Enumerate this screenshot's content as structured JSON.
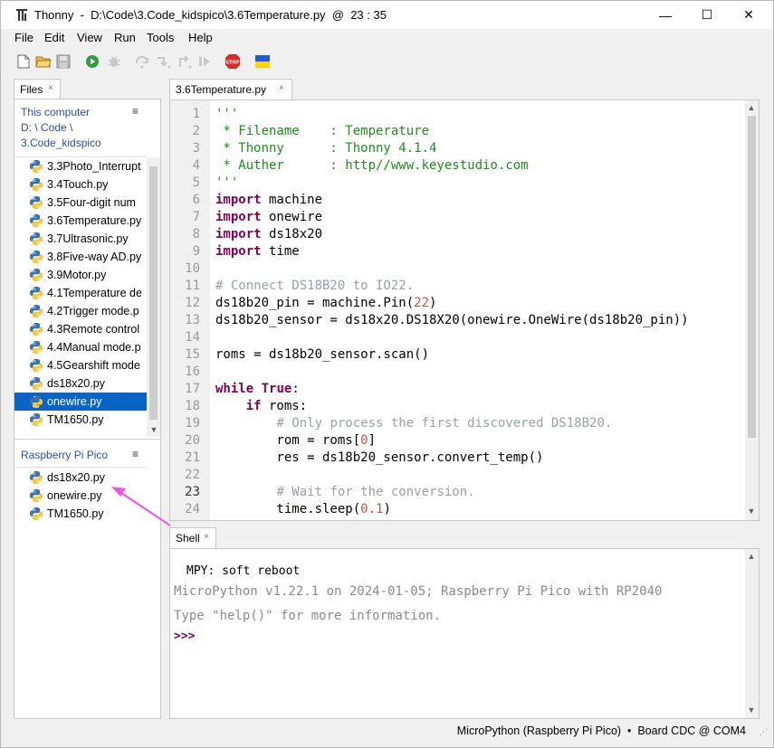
{
  "window": {
    "title": "Thonny  -  D:\\Code\\3.Code_kidspico\\3.6Temperature.py  @  23 : 35",
    "minimize": "—",
    "maximize": "☐",
    "close": "✕"
  },
  "menu": [
    "File",
    "Edit",
    "View",
    "Run",
    "Tools",
    "Help"
  ],
  "toolbar": {
    "icons": [
      "new-file-icon",
      "open-file-icon",
      "save-icon",
      "run-icon",
      "debug-icon",
      "step-over-icon",
      "step-into-icon",
      "step-out-icon",
      "resume-icon",
      "stop-icon",
      "ukraine-flag-icon"
    ],
    "stop_label": "STOP"
  },
  "files": {
    "tab_label": "Files",
    "close": "×",
    "computer": {
      "title_line1": "This computer",
      "title_line2": "D: \\ Code \\",
      "title_line3": "3.Code_kidspico",
      "items": [
        "3.3Photo_Interrupt",
        "3.4Touch.py",
        "3.5Four-digit  num",
        "3.6Temperature.py",
        "3.7Ultrasonic.py",
        "3.8Five-way AD.py",
        "3.9Motor.py",
        "4.1Temperature de",
        "4.2Trigger mode.p",
        "4.3Remote control",
        "4.4Manual mode.p",
        "4.5Gearshift mode",
        "ds18x20.py",
        "onewire.py",
        "TM1650.py"
      ],
      "selected_index": 13
    },
    "device": {
      "title": "Raspberry Pi Pico",
      "items": [
        "ds18x20.py",
        "onewire.py",
        "TM1650.py"
      ]
    },
    "menu_glyph": "≡"
  },
  "editor": {
    "tab_label": "3.6Temperature.py",
    "close": "×",
    "current_line": 23,
    "line_numbers": [
      "1",
      "2",
      "3",
      "4",
      "5",
      "6",
      "7",
      "8",
      "9",
      "10",
      "11",
      "12",
      "13",
      "14",
      "15",
      "16",
      "17",
      "18",
      "19",
      "20",
      "21",
      "22",
      "23",
      "24"
    ],
    "lines": [
      [
        [
          "str",
          "'''"
        ]
      ],
      [
        [
          "str",
          " * Filename    : Temperature"
        ]
      ],
      [
        [
          "str",
          " * Thonny      : Thonny 4.1.4"
        ]
      ],
      [
        [
          "str",
          " * Auther      : http//www.keyestudio.com"
        ]
      ],
      [
        [
          "str",
          "'''"
        ]
      ],
      [
        [
          "kw",
          "import"
        ],
        [
          "nm",
          " machine"
        ]
      ],
      [
        [
          "kw",
          "import"
        ],
        [
          "nm",
          " onewire"
        ]
      ],
      [
        [
          "kw",
          "import"
        ],
        [
          "nm",
          " ds18x20"
        ]
      ],
      [
        [
          "kw",
          "import"
        ],
        [
          "nm",
          " time"
        ]
      ],
      [],
      [
        [
          "cm",
          "# Connect DS18B20 to IO22."
        ]
      ],
      [
        [
          "nm",
          "ds18b20_pin = machine.Pin("
        ],
        [
          "num",
          "22"
        ],
        [
          "nm",
          ")"
        ]
      ],
      [
        [
          "nm",
          "ds18b20_sensor = ds18x20.DS18X20(onewire.OneWire(ds18b20_pin))"
        ]
      ],
      [],
      [
        [
          "nm",
          "roms = ds18b20_sensor.scan()"
        ]
      ],
      [],
      [
        [
          "kw",
          "while"
        ],
        [
          "nm",
          " "
        ],
        [
          "kw",
          "True"
        ],
        [
          "nm",
          ":"
        ]
      ],
      [
        [
          "nm",
          "    "
        ],
        [
          "kw",
          "if"
        ],
        [
          "nm",
          " roms:"
        ]
      ],
      [
        [
          "nm",
          "        "
        ],
        [
          "cm",
          "# Only process the first discovered DS18B20."
        ]
      ],
      [
        [
          "nm",
          "        rom = roms["
        ],
        [
          "num",
          "0"
        ],
        [
          "nm",
          "]"
        ]
      ],
      [
        [
          "nm",
          "        res = ds18b20_sensor.convert_temp()"
        ]
      ],
      [],
      [
        [
          "nm",
          "        "
        ],
        [
          "cm",
          "# Wait for the conversion."
        ]
      ],
      [
        [
          "nm",
          "        time.sleep("
        ],
        [
          "num",
          "0.1"
        ],
        [
          "nm",
          ")"
        ]
      ]
    ]
  },
  "shell": {
    "tab_label": "Shell",
    "close": "×",
    "line1": "MPY: soft reboot",
    "line2": "MicroPython v1.22.1 on 2024-01-05; Raspberry Pi Pico with RP2040",
    "line3": "Type \"help()\" for more information.",
    "prompt": ">>>"
  },
  "status": {
    "text": "MicroPython (Raspberry Pi Pico)  •  Board CDC @ COM4"
  },
  "colors": {
    "selection": "#0a64c8",
    "keyword": "#7f0055",
    "string": "#1a8f1a",
    "comment": "#9aa0a6",
    "number": "#c75450",
    "annotation_arrow": "#ee55ee"
  }
}
